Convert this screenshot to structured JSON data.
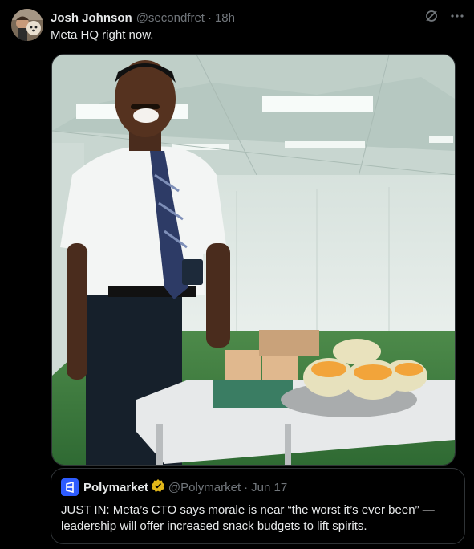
{
  "post": {
    "author_name": "Josh Johnson",
    "author_handle": "@secondfret",
    "separator": "·",
    "time": "18h",
    "text": "Meta HQ right now."
  },
  "media": {
    "icons": [
      "grok-icon",
      "more-icon"
    ]
  },
  "quote": {
    "author_name": "Polymarket",
    "author_handle": "@Polymarket",
    "separator": "·",
    "date": "Jun 17",
    "verified": "gold",
    "text": "JUST IN: Meta’s CTO says morale is near “the worst it’s ever been” — leadership will offer increased snack budgets to lift spirits."
  },
  "colors": {
    "background": "#000000",
    "text": "#e7e9ea",
    "muted": "#71767b",
    "border": "#2f3336",
    "polymarket_blue": "#2e5cff",
    "verified_gold": "#e2b719"
  }
}
